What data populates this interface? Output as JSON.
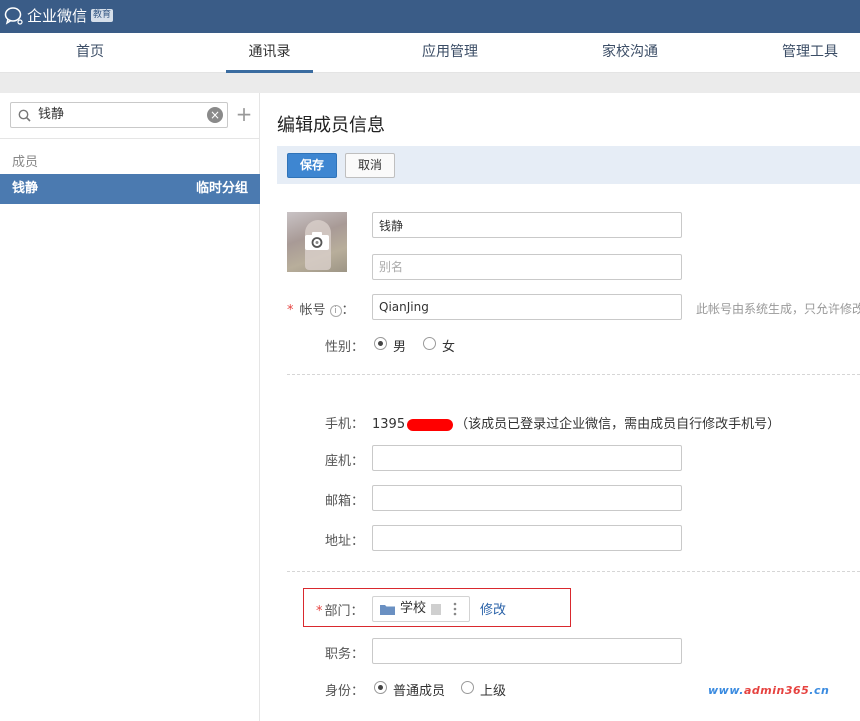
{
  "app": {
    "title": "企业微信",
    "badge": "教育"
  },
  "nav": {
    "items": [
      "首页",
      "通讯录",
      "应用管理",
      "家校沟通",
      "管理工具"
    ],
    "active_index": 1
  },
  "sidebar": {
    "search_value": "钱静",
    "section_label": "成员",
    "member": {
      "name": "钱静",
      "group": "临时分组"
    }
  },
  "main": {
    "title": "编辑成员信息",
    "save_label": "保存",
    "cancel_label": "取消",
    "name_value": "钱静",
    "alias_placeholder": "别名",
    "account_label": "帐号",
    "account_required": "*",
    "account_info_icon": "i",
    "account_value": "QianJing",
    "account_hint": "此帐号由系统生成，只允许修改",
    "gender_label": "性别：",
    "gender_options": [
      "男",
      "女"
    ],
    "gender_selected": "男",
    "phone_label": "手机：",
    "phone_prefix": "1395",
    "phone_note": "（该成员已登录过企业微信，需由成员自行修改手机号）",
    "landline_label": "座机：",
    "email_label": "邮箱：",
    "address_label": "地址：",
    "dept_label": "部门：",
    "dept_required": "*",
    "dept_name": "学校",
    "dept_edit_label": "修改",
    "position_label": "职务：",
    "identity_label": "身份：",
    "identity_options": [
      "普通成员",
      "上级"
    ],
    "identity_selected": "普通成员",
    "colon": "："
  },
  "watermark": {
    "prefix": "www.",
    "name": "admin365",
    "suffix": ".cn"
  },
  "colors": {
    "topbar": "#3a5c87",
    "accent": "#3e86d1",
    "selected_row": "#4b7ab0",
    "required": "#e64340",
    "highlight_box": "#d9292e"
  }
}
